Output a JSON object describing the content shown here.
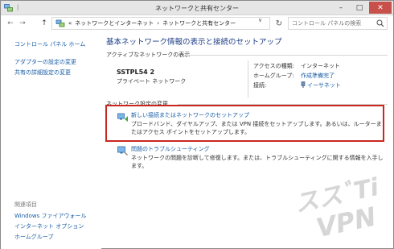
{
  "window": {
    "title": "ネットワークと共有センター",
    "minimize_glyph": "–",
    "maximize_glyph": "□",
    "close_glyph": "✕"
  },
  "addressbar": {
    "back_glyph": "←",
    "forward_glyph": "→",
    "up_glyph": "↑",
    "breadcrumb_prefix": "«",
    "breadcrumb": [
      "ネットワークとインターネット",
      "ネットワークと共有センター"
    ],
    "breadcrumb_sep": "›",
    "dropdown_glyph": "∨",
    "refresh_glyph": "↻",
    "search_placeholder": "コントロール パネルの検索"
  },
  "sidebar": {
    "home_link": "コントロール パネル ホーム",
    "links": [
      "アダプターの設定の変更",
      "共有の詳細設定の変更"
    ],
    "related_heading": "関連項目",
    "related_links": [
      "Windows ファイアウォール",
      "インターネット オプション",
      "ホームグループ"
    ]
  },
  "main": {
    "title": "基本ネットワーク情報の表示と接続のセットアップ",
    "active_networks_label": "アクティブなネットワークの表示",
    "network": {
      "name": "SSTPL54  2",
      "type": "プライベート ネットワーク",
      "access_type_label": "アクセスの種類:",
      "access_type_value": "インターネット",
      "homegroup_label": "ホームグループ:",
      "homegroup_value": "作成準備完了",
      "connection_label": "接続:",
      "connection_value": "イーサネット"
    },
    "change_settings_label": "ネットワーク設定の変更",
    "tasks": [
      {
        "title": "新しい接続またはネットワークのセットアップ",
        "desc": "ブロードバンド、ダイヤルアップ、または VPN 接続をセットアップします。あるいは、ルーターまたはアクセス ポイントをセットアップします。"
      },
      {
        "title": "問題のトラブルシューティング",
        "desc": "ネットワークの問題を診断して修復します。または、トラブルシューティングに関する情報を入手します。"
      }
    ]
  },
  "watermark": {
    "line1": "ススﾞTi",
    "line2": "VPN"
  },
  "colors": {
    "link": "#1a5ea6",
    "title": "#1e3e86",
    "highlight": "#c8281f",
    "close_button": "#c7504b"
  }
}
